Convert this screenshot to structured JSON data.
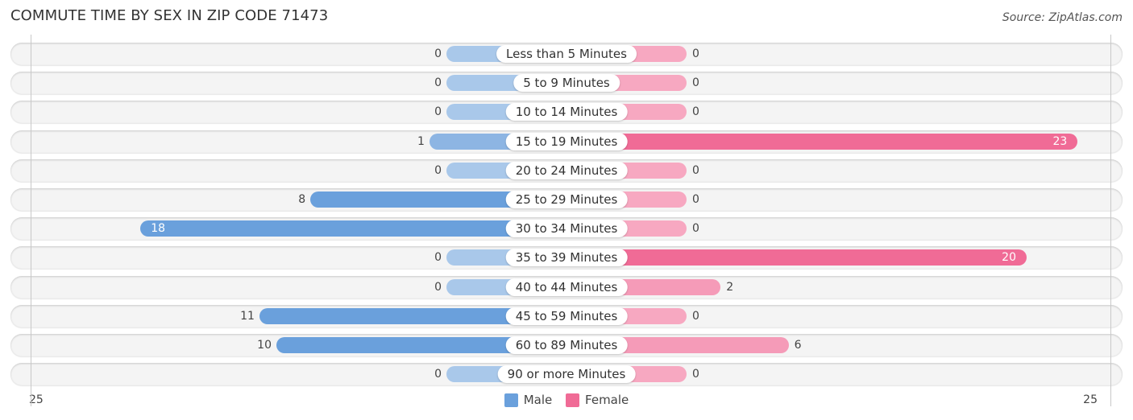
{
  "header": {
    "title": "COMMUTE TIME BY SEX IN ZIP CODE 71473",
    "source": "Source: ZipAtlas.com"
  },
  "colors": {
    "male": "#6aa0dc",
    "male_light": "#a9c8ea",
    "female": "#f06b96",
    "female_light": "#f7a8c1"
  },
  "chart_data": {
    "type": "bar",
    "orientation": "horizontal-diverging",
    "title": "COMMUTE TIME BY SEX IN ZIP CODE 71473",
    "categories": [
      "Less than 5 Minutes",
      "5 to 9 Minutes",
      "10 to 14 Minutes",
      "15 to 19 Minutes",
      "20 to 24 Minutes",
      "25 to 29 Minutes",
      "30 to 34 Minutes",
      "35 to 39 Minutes",
      "40 to 44 Minutes",
      "45 to 59 Minutes",
      "60 to 89 Minutes",
      "90 or more Minutes"
    ],
    "series": [
      {
        "name": "Male",
        "side": "left",
        "values": [
          0,
          0,
          0,
          1,
          0,
          8,
          18,
          0,
          0,
          11,
          10,
          0
        ]
      },
      {
        "name": "Female",
        "side": "right",
        "values": [
          0,
          0,
          0,
          23,
          0,
          0,
          0,
          20,
          2,
          0,
          6,
          0
        ]
      }
    ],
    "axis": {
      "left_label": "25",
      "right_label": "25",
      "range": [
        25,
        25
      ]
    },
    "legend": {
      "position": "bottom-center",
      "entries": [
        "Male",
        "Female"
      ]
    }
  }
}
